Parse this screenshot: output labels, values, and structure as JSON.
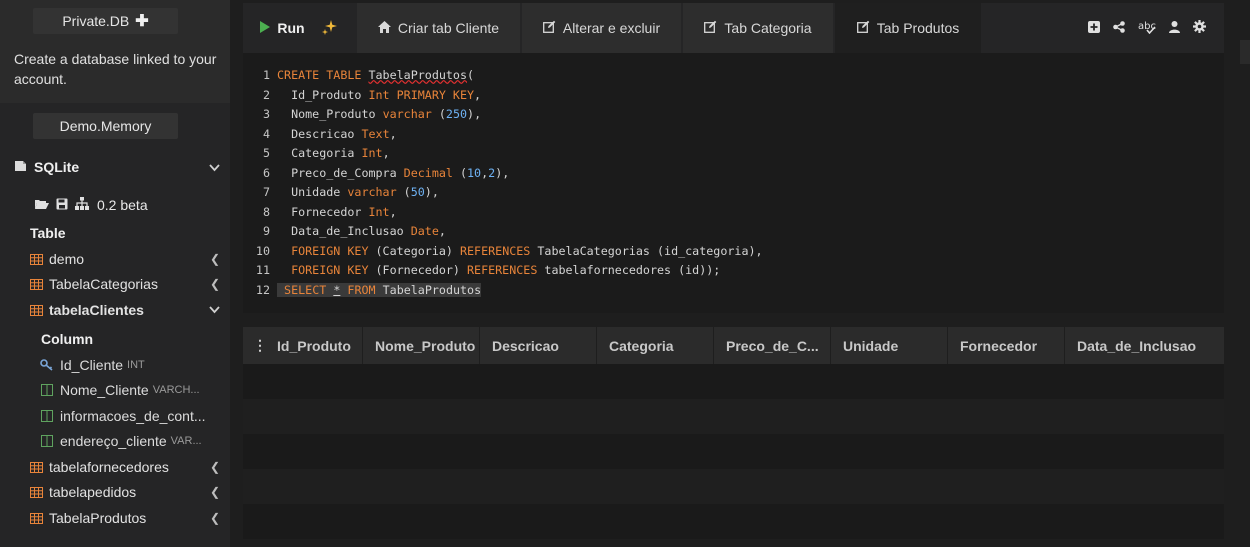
{
  "sidebar": {
    "private_db_label": "Private.DB",
    "create_db_text": "Create a database linked to your account.",
    "demo_memory_label": "Demo.Memory",
    "sqlite_label": "SQLite",
    "version_label": "0.2 beta",
    "table_section": "Table",
    "column_section": "Column",
    "tables": [
      {
        "name": "demo"
      },
      {
        "name": "TabelaCategorias"
      },
      {
        "name": "tabelaClientes"
      },
      {
        "name": "tabelafornecedores"
      },
      {
        "name": "tabelapedidos"
      },
      {
        "name": "TabelaProdutos"
      }
    ],
    "columns": [
      {
        "name": "Id_Cliente",
        "type": "INT"
      },
      {
        "name": "Nome_Cliente",
        "type": "VARCH..."
      },
      {
        "name": "informacoes_de_cont...",
        "type": ""
      },
      {
        "name": "endereço_cliente",
        "type": "VAR..."
      }
    ]
  },
  "tabs": {
    "run": "Run",
    "t1": "Criar tab Cliente",
    "t2": "Alterar e excluir",
    "t3": "Tab Categoria",
    "t4": "Tab Produtos"
  },
  "editor": {
    "line_numbers": [
      "1",
      "2",
      "3",
      "4",
      "5",
      "6",
      "7",
      "8",
      "9",
      "10",
      "11",
      "12"
    ]
  },
  "grid": {
    "columns": [
      "Id_Produto",
      "Nome_Produto",
      "Descricao",
      "Categoria",
      "Preco_de_C...",
      "Unidade",
      "Fornecedor",
      "Data_de_Inclusao"
    ]
  },
  "colors": {
    "keyword": "#e8843a",
    "number": "#6fb3f5",
    "run_icon": "#4caf50",
    "table_icon": "#e8843a",
    "column_icon": "#5fa35f",
    "key_icon": "#7aa6d8"
  },
  "icons": {
    "run": "play-icon",
    "magic": "sparkles-icon",
    "home": "home-icon",
    "edit": "edit-icon",
    "add": "plus-square-icon",
    "share": "share-icon",
    "spell": "spellcheck-icon",
    "user": "user-icon",
    "settings": "gear-icon"
  }
}
